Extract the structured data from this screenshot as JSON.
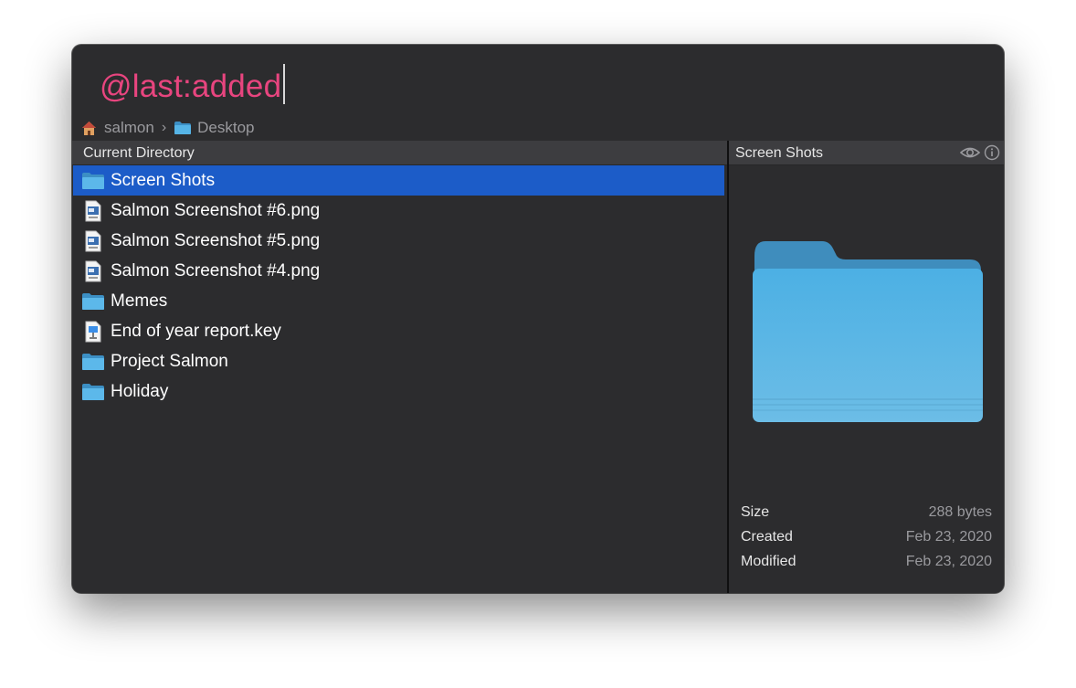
{
  "query": {
    "text": "@last:added"
  },
  "breadcrumb": [
    {
      "label": "salmon",
      "icon": "home-icon"
    },
    {
      "label": "Desktop",
      "icon": "folder-icon"
    }
  ],
  "left_pane": {
    "header": "Current Directory",
    "items": [
      {
        "name": "Screen Shots",
        "icon": "folder-icon",
        "selected": true
      },
      {
        "name": "Salmon Screenshot #6.png",
        "icon": "png-file-icon"
      },
      {
        "name": "Salmon Screenshot #5.png",
        "icon": "png-file-icon"
      },
      {
        "name": "Salmon Screenshot #4.png",
        "icon": "png-file-icon"
      },
      {
        "name": "Memes",
        "icon": "folder-icon"
      },
      {
        "name": "End of year report.key",
        "icon": "keynote-file-icon"
      },
      {
        "name": "Project Salmon",
        "icon": "folder-icon"
      },
      {
        "name": "Holiday",
        "icon": "folder-icon"
      }
    ]
  },
  "right_pane": {
    "header": "Screen Shots",
    "header_icons": [
      "eye-icon",
      "info-icon"
    ],
    "preview_icon": "large-folder-icon",
    "meta": [
      {
        "key": "Size",
        "value": "288 bytes"
      },
      {
        "key": "Created",
        "value": "Feb 23, 2020"
      },
      {
        "key": "Modified",
        "value": "Feb 23, 2020"
      }
    ]
  },
  "colors": {
    "query_text": "#e8457f",
    "selection": "#1c5cc8",
    "window_bg": "#2c2c2e",
    "folder_blue": "#4aa8dc"
  }
}
